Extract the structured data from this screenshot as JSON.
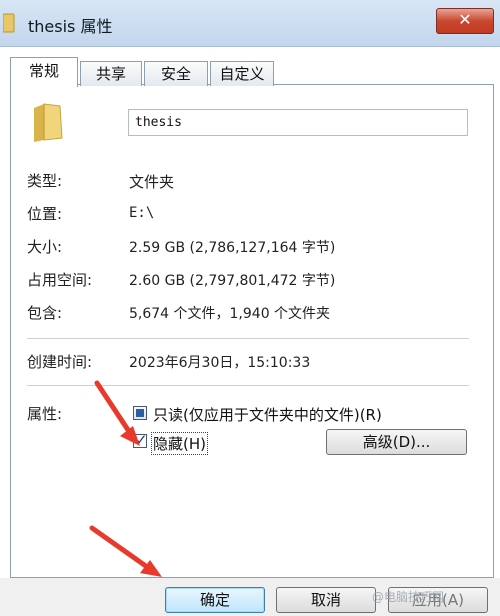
{
  "window": {
    "title": "thesis 属性",
    "close_label": "✕"
  },
  "tabs": [
    {
      "label": "常规",
      "active": true
    },
    {
      "label": "共享",
      "active": false
    },
    {
      "label": "安全",
      "active": false
    },
    {
      "label": "自定义",
      "active": false
    }
  ],
  "general": {
    "name_value": "thesis",
    "rows": [
      {
        "label": "类型:",
        "value": "文件夹"
      },
      {
        "label": "位置:",
        "value": "E:\\"
      },
      {
        "label": "大小:",
        "value": "2.59 GB (2,786,127,164 字节)"
      },
      {
        "label": "占用空间:",
        "value": "2.60 GB (2,797,801,472 字节)"
      },
      {
        "label": "包含:",
        "value": "5,674 个文件，1,940 个文件夹"
      }
    ],
    "created_label": "创建时间:",
    "created_value": "2023年6月30日，15:10:33",
    "attributes_label": "属性:",
    "readonly_label": "只读(仅应用于文件夹中的文件)(R)",
    "readonly_state": "indeterminate",
    "hidden_label": "隐藏(H)",
    "hidden_checked": true,
    "advanced_label": "高级(D)..."
  },
  "footer": {
    "ok_label": "确定",
    "cancel_label": "取消",
    "apply_label": "应用(A)"
  },
  "watermark_text": "@电脑技巧网",
  "colors": {
    "arrow": "#e8392b",
    "titlebar": "#c9dbef",
    "close_button": "#c8482f"
  },
  "icons": {
    "folder": "folder-icon",
    "close": "close-icon"
  }
}
